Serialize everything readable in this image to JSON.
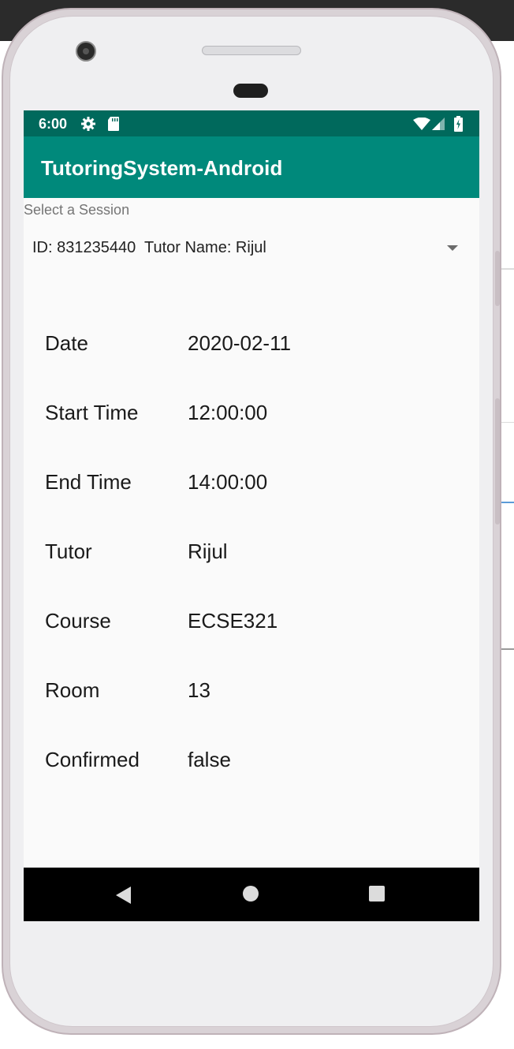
{
  "status_bar": {
    "time": "6:00",
    "icons": [
      "gear-icon",
      "sd-card-icon",
      "wifi-icon",
      "signal-icon",
      "battery-charging-icon"
    ]
  },
  "app_bar": {
    "title": "TutoringSystem-Android"
  },
  "session_select": {
    "label": "Select a Session",
    "selected": "ID: 831235440  Tutor Name: Rijul"
  },
  "details": [
    {
      "label": "Date",
      "value": "2020-02-11"
    },
    {
      "label": "Start Time",
      "value": "12:00:00"
    },
    {
      "label": "End Time",
      "value": "14:00:00"
    },
    {
      "label": "Tutor",
      "value": "Rijul"
    },
    {
      "label": "Course",
      "value": "ECSE321"
    },
    {
      "label": "Room",
      "value": "13"
    },
    {
      "label": "Confirmed",
      "value": "false"
    }
  ],
  "nav_bar": {
    "icons": [
      "back-icon",
      "home-icon",
      "recents-icon"
    ]
  },
  "colors": {
    "status_bar": "#00695c",
    "app_bar": "#00897b",
    "screen_bg": "#fafafa",
    "nav_bar": "#000000"
  }
}
